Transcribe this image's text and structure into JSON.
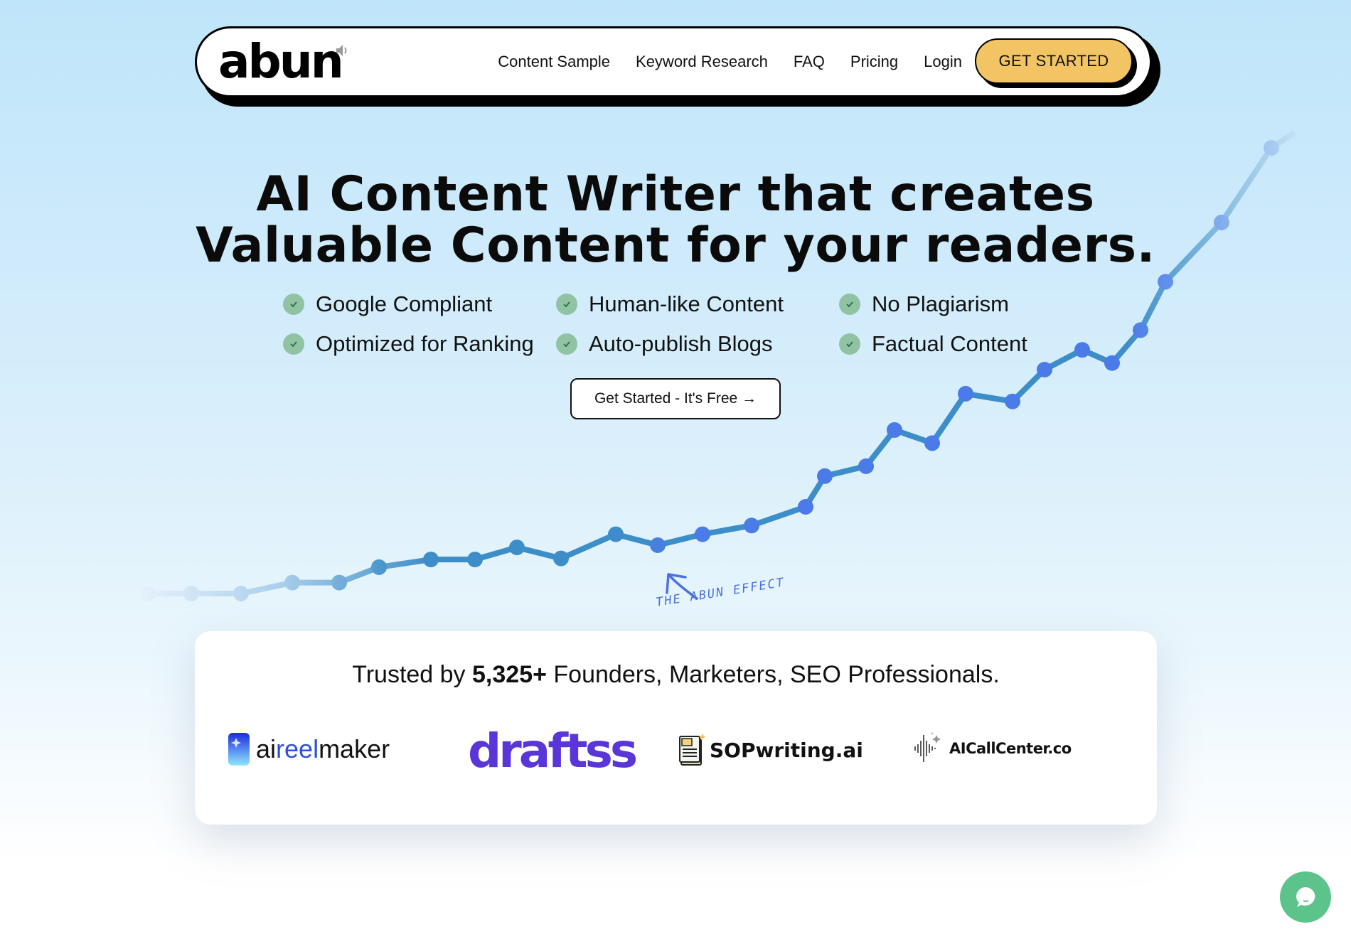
{
  "nav": {
    "logo_text": "abun",
    "links": [
      "Content Sample",
      "Keyword Research",
      "FAQ",
      "Pricing",
      "Login"
    ],
    "cta_label": "GET STARTED"
  },
  "hero": {
    "headline_line1": "AI Content Writer that creates",
    "headline_line2": "Valuable Content for your readers.",
    "features": [
      "Google Compliant",
      "Human-like Content",
      "No Plagiarism",
      "Optimized for Ranking",
      "Auto-publish Blogs",
      "Factual Content"
    ],
    "cta_label": "Get Started - It's Free →",
    "effect_label": "THE ABUN EFFECT"
  },
  "chart_data": {
    "type": "line",
    "title": "",
    "xlabel": "",
    "ylabel": "",
    "description": "Decorative growth curve; relative values (0 = baseline)",
    "values": [
      0,
      0,
      0,
      1,
      1,
      2.4,
      3.1,
      3.1,
      4.2,
      3.2,
      5.4,
      4.4,
      5.4,
      6.2,
      7.9,
      10.7,
      11.6,
      14.9,
      13.7,
      18.2,
      17.5,
      20.4,
      22.2,
      21.0,
      24.0,
      28.4,
      33.8,
      40.6
    ],
    "colors": {
      "line": "#3b8ec8",
      "marker": "#4a7be8"
    }
  },
  "trusted": {
    "prefix": "Trusted by ",
    "count": "5,325+",
    "suffix": " Founders, Marketers, SEO Professionals.",
    "logos": [
      {
        "name": "aireelmaker",
        "parts": [
          "ai",
          "reel",
          "maker"
        ]
      },
      {
        "name": "draftss"
      },
      {
        "name": "SOPwriting.ai"
      },
      {
        "name": "AICallCenter.co"
      }
    ]
  },
  "chat": {
    "icon": "chat-icon"
  }
}
